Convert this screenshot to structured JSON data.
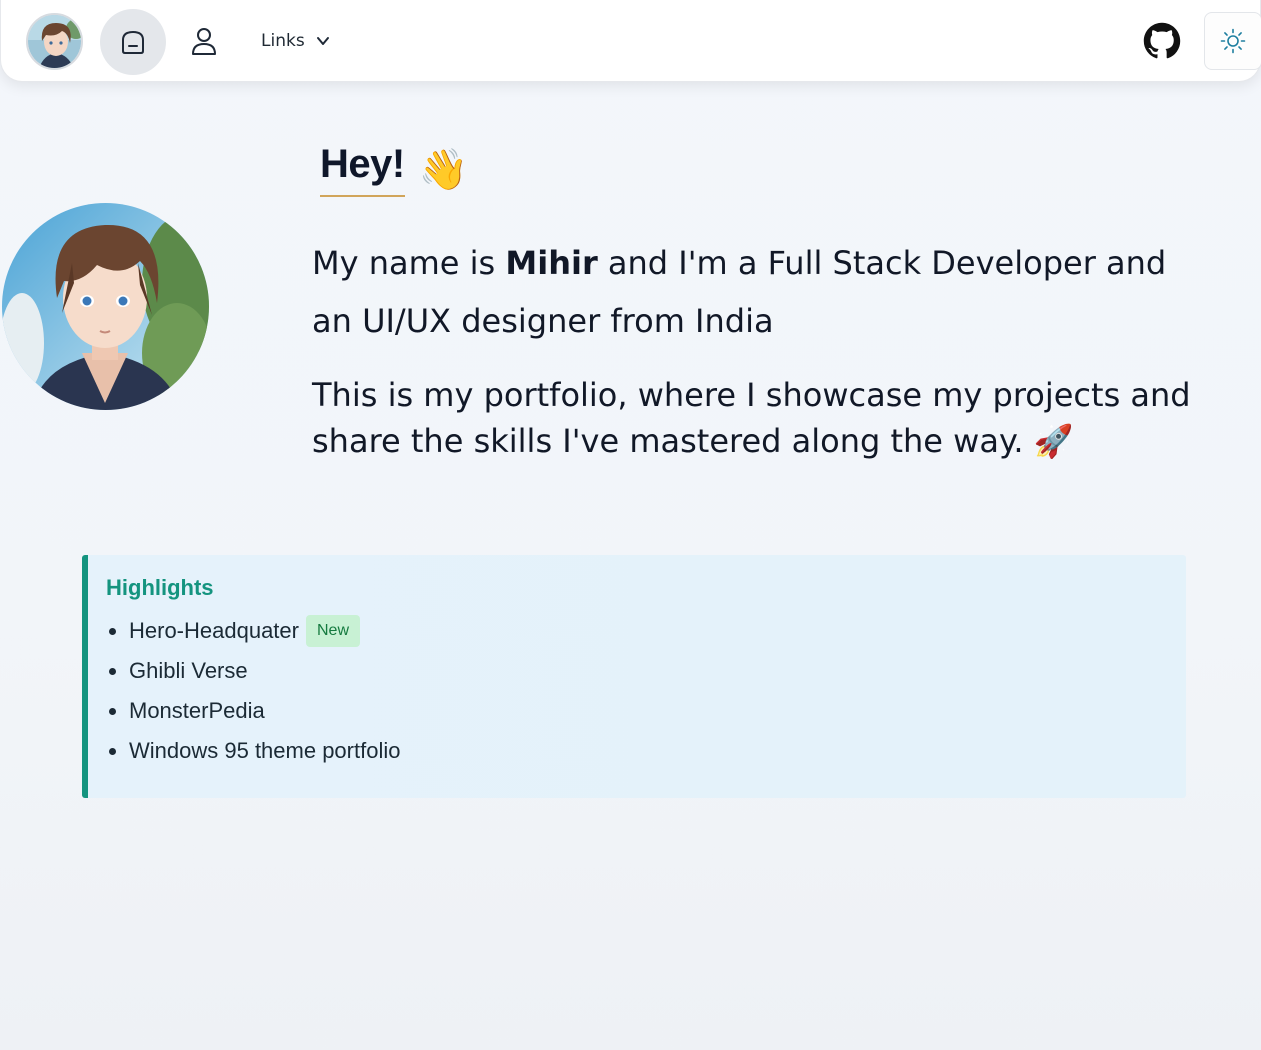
{
  "nav": {
    "links_label": "Links",
    "icons": {
      "home": "home-icon",
      "user": "user-icon",
      "chevron": "chevron-down-icon",
      "github": "github-icon",
      "theme": "sun-icon"
    }
  },
  "hero": {
    "greeting": "Hey!",
    "wave_emoji": "👋",
    "intro_before": "My name is ",
    "name": "Mihir",
    "intro_after": " and I'm a Full Stack Developer and an UI/UX designer from India",
    "intro_2": "This is my portfolio, where I showcase my projects and share the skills I've mastered along the way.",
    "rocket_emoji": "🚀"
  },
  "highlights": {
    "title": "Highlights",
    "items": [
      {
        "label": "Hero-Headquater",
        "badge": "New"
      },
      {
        "label": "Ghibli Verse"
      },
      {
        "label": "MonsterPedia"
      },
      {
        "label": "Windows 95 theme portfolio"
      }
    ]
  },
  "colors": {
    "accent": "#14947f",
    "badge_bg": "#c8f1d4",
    "badge_text": "#157a3f",
    "highlight_bg": "#e5f2fb",
    "underline": "#d1a55a"
  }
}
